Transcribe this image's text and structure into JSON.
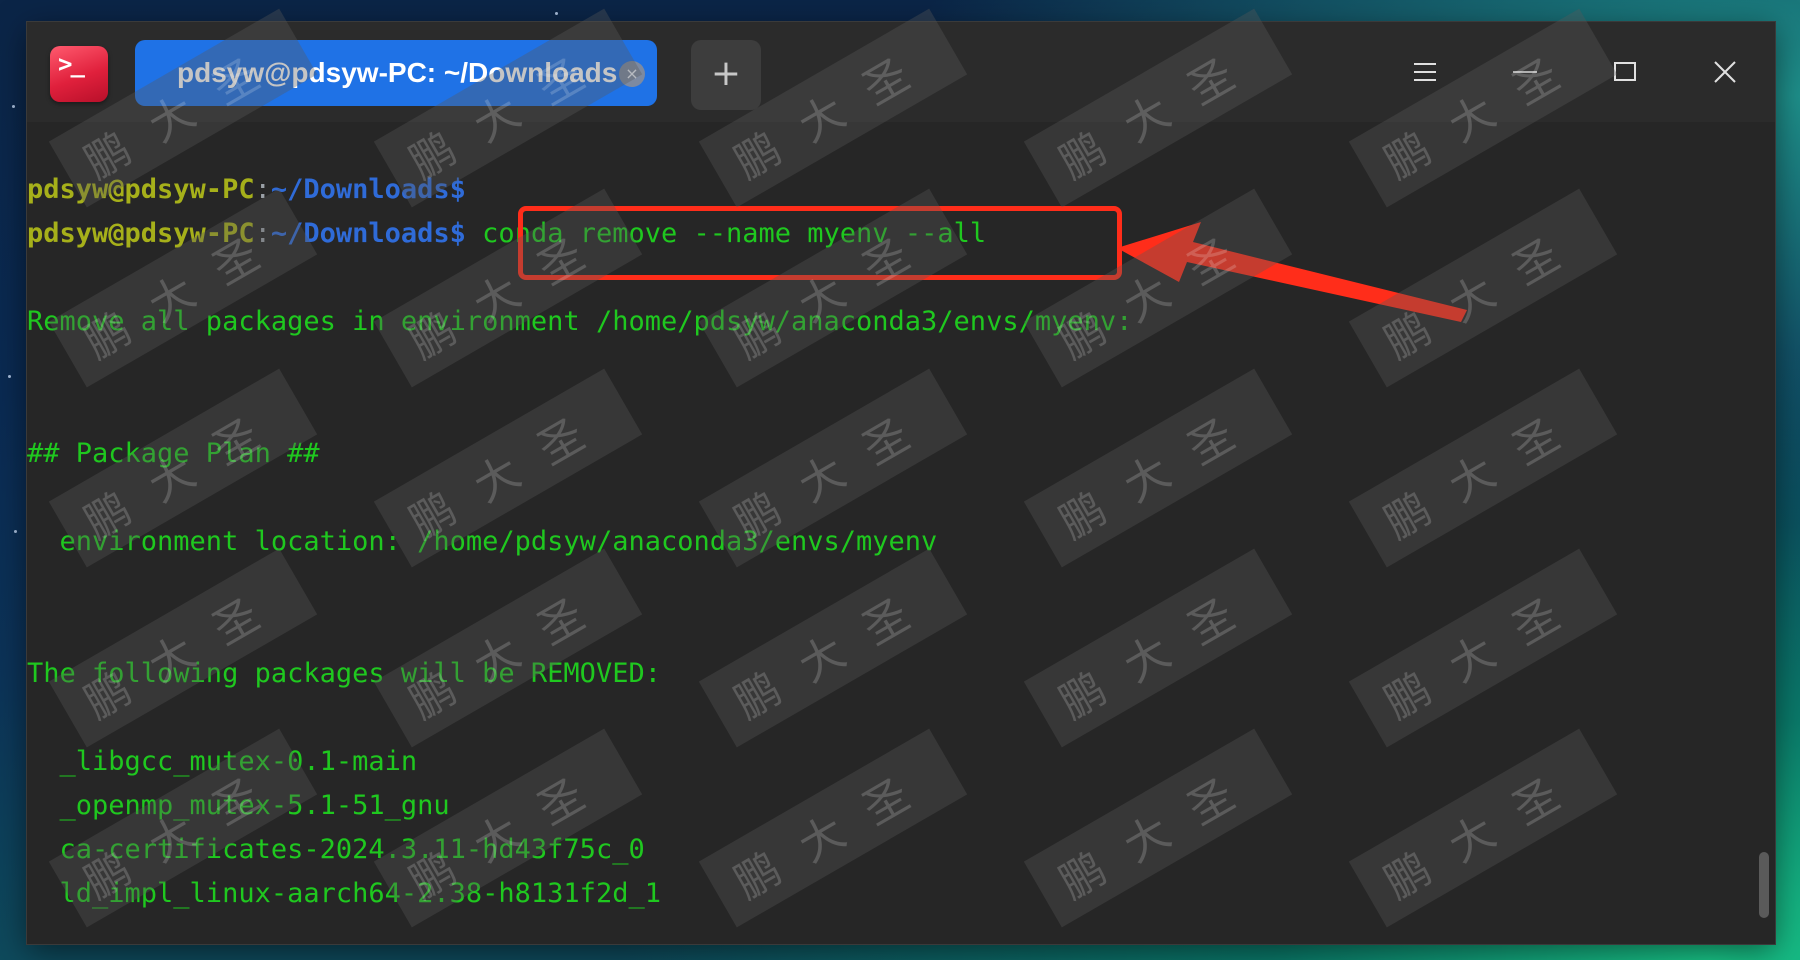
{
  "tab": {
    "title": "pdsyw@pdsyw-PC: ~/Downloads",
    "close_glyph": "×"
  },
  "toolbar": {
    "add_tab_glyph": "+",
    "menu_icon": "hamburger-menu-icon",
    "minimize_icon": "minimize-icon",
    "maximize_icon": "maximize-icon",
    "close_icon": "close-icon"
  },
  "app_icon_glyph": ">_",
  "terminal": {
    "prompt_user": "pdsyw@pdsyw-PC",
    "prompt_colon": ":",
    "prompt_path": "~/Downloads$",
    "command": " conda remove --name myenv --all",
    "lines": [
      "Remove all packages in environment /home/pdsyw/anaconda3/envs/myenv:",
      "## Package Plan ##",
      "  environment location: /home/pdsyw/anaconda3/envs/myenv",
      "The following packages will be REMOVED:",
      "  _libgcc_mutex-0.1-main",
      "  _openmp_mutex-5.1-51_gnu",
      "  ca-certificates-2024.3.11-hd43f75c_0",
      "  ld_impl_linux-aarch64-2.38-h8131f2d_1"
    ]
  },
  "watermark_text": "鹏大圣",
  "colors": {
    "tab_active": "#1f72e6",
    "terminal_text": "#1fc81f",
    "prompt_user": "#a6b01a",
    "prompt_path": "#2f6bd8",
    "highlight_box": "#ff2d1a",
    "terminal_bg": "#262626"
  }
}
